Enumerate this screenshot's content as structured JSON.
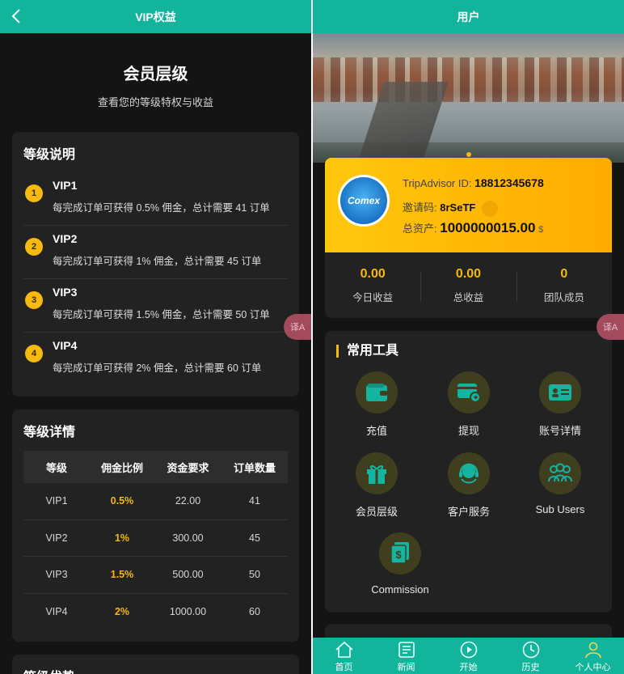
{
  "left": {
    "topbar_title": "VIP权益",
    "hero": {
      "title": "会员层级",
      "subtitle": "查看您的等级特权与收益"
    },
    "levels_card": {
      "title": "等级说明",
      "items": [
        {
          "num": "1",
          "name": "VIP1",
          "desc": "每完成订单可获得 0.5% 佣金，总计需要 41 订单"
        },
        {
          "num": "2",
          "name": "VIP2",
          "desc": "每完成订单可获得 1% 佣金，总计需要 45 订单"
        },
        {
          "num": "3",
          "name": "VIP3",
          "desc": "每完成订单可获得 1.5% 佣金，总计需要 50 订单"
        },
        {
          "num": "4",
          "name": "VIP4",
          "desc": "每完成订单可获得 2% 佣金，总计需要 60 订单"
        }
      ]
    },
    "details_card": {
      "title": "等级详情",
      "headers": [
        "等级",
        "佣金比例",
        "资金要求",
        "订单数量"
      ],
      "rows": [
        [
          "VIP1",
          "0.5%",
          "22.00",
          "41"
        ],
        [
          "VIP2",
          "1%",
          "300.00",
          "45"
        ],
        [
          "VIP3",
          "1.5%",
          "500.00",
          "50"
        ],
        [
          "VIP4",
          "2%",
          "1000.00",
          "60"
        ]
      ]
    },
    "next_card_title": "等级优势"
  },
  "right": {
    "topbar_title": "用户",
    "user": {
      "avatar_text": "Comex",
      "id_label": "TripAdvisor ID:",
      "id_value": "18812345678",
      "invite_label": "邀请码:",
      "invite_value": "8rSeTF",
      "assets_label": "总资产:",
      "assets_value": "1000000015.00",
      "assets_unit": "$"
    },
    "stats": [
      {
        "value": "0.00",
        "label": "今日收益"
      },
      {
        "value": "0.00",
        "label": "总收益"
      },
      {
        "value": "0",
        "label": "团队成员"
      }
    ],
    "tools": {
      "title": "常用工具",
      "items": [
        {
          "label": "充值",
          "icon": "wallet-icon"
        },
        {
          "label": "提现",
          "icon": "withdraw-card-icon"
        },
        {
          "label": "账号详情",
          "icon": "id-card-icon"
        },
        {
          "label": "会员层级",
          "icon": "gift-icon"
        },
        {
          "label": "客户服务",
          "icon": "headset-icon"
        },
        {
          "label": "Sub Users",
          "icon": "users-icon"
        },
        {
          "label": "Commission",
          "icon": "commission-icon"
        }
      ]
    },
    "tabbar": [
      {
        "label": "首页",
        "icon": "home-icon"
      },
      {
        "label": "新闻",
        "icon": "news-icon"
      },
      {
        "label": "开始",
        "icon": "play-icon"
      },
      {
        "label": "历史",
        "icon": "history-icon"
      },
      {
        "label": "个人中心",
        "icon": "user-icon",
        "active": true
      }
    ]
  },
  "translate_button": "译A",
  "colors": {
    "teal": "#12b49c",
    "gold": "#f6b90f",
    "card": "#222222",
    "bg": "#141414"
  }
}
